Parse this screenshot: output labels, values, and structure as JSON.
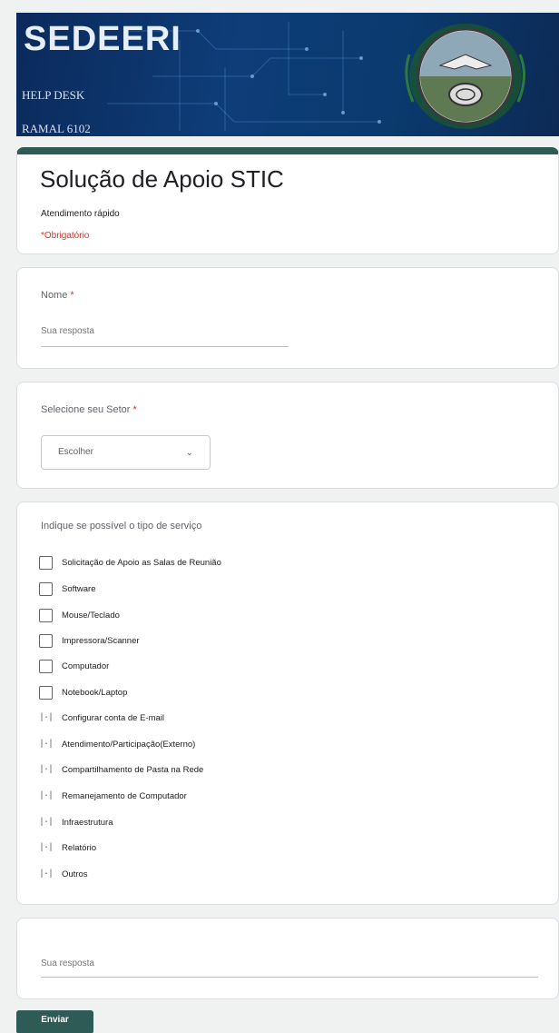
{
  "banner": {
    "title": "SEDEERI",
    "subtitle": "HELP DESK",
    "ramal": "RAMAL 6102"
  },
  "form": {
    "title": "Solução de Apoio STIC",
    "description": "Atendimento rápido",
    "required_note": "*Obrigatório"
  },
  "name_question": {
    "label": "Nome",
    "required_mark": "*",
    "placeholder": "Sua resposta"
  },
  "sector_question": {
    "label": "Selecione seu Setor",
    "required_mark": "*",
    "selected": "Escolher",
    "caret": "⌄"
  },
  "service_question": {
    "label": "Indique se possível o tipo de serviço",
    "options_checkbox": [
      "Solicitação de Apoio as Salas de Reunião",
      "Software",
      "Mouse/Teclado",
      "Impressora/Scanner",
      "Computador",
      "Notebook/Laptop"
    ],
    "options_bracket": [
      "Configurar conta de E-mail",
      "Atendimento/Participação(Externo)",
      "Compartilhamento de Pasta na Rede",
      "Remanejamento de Computador",
      "Infraestrutura",
      "Relatório",
      "Outros"
    ],
    "bracket_glyph": "|·|"
  },
  "other_question": {
    "placeholder": "Sua resposta"
  },
  "submit": {
    "label": "Enviar"
  },
  "colors": {
    "theme": "#2f5b56",
    "required": "#d93025",
    "background": "#f0f2f1"
  }
}
